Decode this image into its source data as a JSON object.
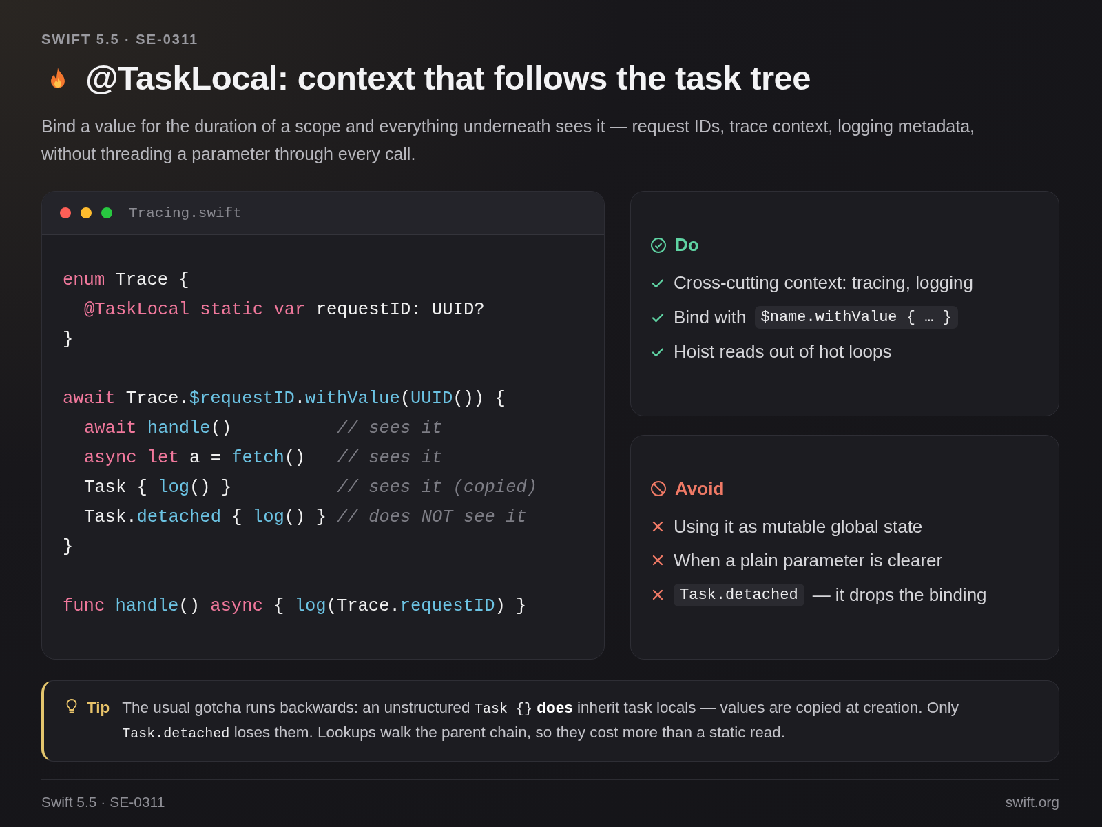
{
  "eyebrow": "SWIFT 5.5 · SE-0311",
  "title": "@TaskLocal: context that follows the task tree",
  "subtitle": "Bind a value for the duration of a scope and everything underneath sees it — request IDs, trace context, logging metadata, without threading a parameter through every call.",
  "code_window": {
    "filename": "Tracing.swift",
    "blocks": [
      [
        {
          "indent": false,
          "tokens": [
            {
              "kind": "kw",
              "t": "enum "
            },
            {
              "kind": "plain",
              "t": "Trace {"
            }
          ]
        },
        {
          "indent": true,
          "tokens": [
            {
              "kind": "kw",
              "t": "@TaskLocal static var "
            },
            {
              "kind": "plain",
              "t": "requestID: UUID?"
            }
          ]
        },
        {
          "indent": false,
          "tokens": [
            {
              "kind": "plain",
              "t": "}"
            }
          ]
        }
      ],
      [
        {
          "indent": false,
          "tokens": [
            {
              "kind": "kw",
              "t": "await "
            },
            {
              "kind": "plain",
              "t": "Trace."
            },
            {
              "kind": "fn",
              "t": "$requestID"
            },
            {
              "kind": "plain",
              "t": "."
            },
            {
              "kind": "fn",
              "t": "withValue"
            },
            {
              "kind": "plain",
              "t": "("
            },
            {
              "kind": "fn",
              "t": "UUID"
            },
            {
              "kind": "plain",
              "t": "()) {"
            }
          ]
        },
        {
          "indent": true,
          "tokens": [
            {
              "kind": "kw",
              "t": "await "
            },
            {
              "kind": "fn",
              "t": "handle"
            },
            {
              "kind": "plain",
              "t": "()          "
            },
            {
              "kind": "comment",
              "t": "// sees it"
            }
          ]
        },
        {
          "indent": true,
          "tokens": [
            {
              "kind": "kw",
              "t": "async let "
            },
            {
              "kind": "plain",
              "t": "a = "
            },
            {
              "kind": "fn",
              "t": "fetch"
            },
            {
              "kind": "plain",
              "t": "()   "
            },
            {
              "kind": "comment",
              "t": "// sees it"
            }
          ]
        },
        {
          "indent": true,
          "tokens": [
            {
              "kind": "plain",
              "t": "Task { "
            },
            {
              "kind": "fn",
              "t": "log"
            },
            {
              "kind": "plain",
              "t": "() }          "
            },
            {
              "kind": "comment",
              "t": "// sees it (copied)"
            }
          ]
        },
        {
          "indent": true,
          "tokens": [
            {
              "kind": "plain",
              "t": "Task."
            },
            {
              "kind": "fn",
              "t": "detached"
            },
            {
              "kind": "plain",
              "t": " { "
            },
            {
              "kind": "fn",
              "t": "log"
            },
            {
              "kind": "plain",
              "t": "() } "
            },
            {
              "kind": "comment",
              "t": "// does NOT see it"
            }
          ]
        },
        {
          "indent": false,
          "tokens": [
            {
              "kind": "plain",
              "t": "}"
            }
          ]
        }
      ],
      [
        {
          "indent": false,
          "tokens": [
            {
              "kind": "kw",
              "t": "func "
            },
            {
              "kind": "fn",
              "t": "handle"
            },
            {
              "kind": "plain",
              "t": "() "
            },
            {
              "kind": "kw",
              "t": "async "
            },
            {
              "kind": "plain",
              "t": "{ "
            },
            {
              "kind": "fn",
              "t": "log"
            },
            {
              "kind": "plain",
              "t": "(Trace."
            },
            {
              "kind": "fn",
              "t": "requestID"
            },
            {
              "kind": "plain",
              "t": ") }"
            }
          ]
        }
      ]
    ]
  },
  "panels": [
    {
      "kind": "do",
      "heading": "Do",
      "items": [
        [
          {
            "kind": "text",
            "text": "Cross-cutting context: tracing, logging"
          }
        ],
        [
          {
            "kind": "text",
            "text": "Bind with"
          },
          {
            "kind": "code",
            "text": "$name.withValue { … }"
          }
        ],
        [
          {
            "kind": "text",
            "text": "Hoist reads out of hot loops"
          }
        ]
      ]
    },
    {
      "kind": "avoid",
      "heading": "Avoid",
      "items": [
        [
          {
            "kind": "text",
            "text": "Using it as mutable global state"
          }
        ],
        [
          {
            "kind": "text",
            "text": "When a plain parameter is clearer"
          }
        ],
        [
          {
            "kind": "code",
            "text": "Task.detached"
          },
          {
            "kind": "text",
            "text": "— it drops the binding"
          }
        ]
      ]
    }
  ],
  "tip": {
    "label": "Tip",
    "segments": [
      {
        "kind": "text",
        "text": "The usual gotcha runs backwards: an unstructured "
      },
      {
        "kind": "code",
        "text": "Task {}"
      },
      {
        "kind": "text",
        "text": " **does** inherit task locals — values are copied at creation. Only "
      },
      {
        "kind": "code",
        "text": "Task.detached"
      },
      {
        "kind": "text",
        "text": " loses them. Lookups walk the parent chain, so they cost more than a static read."
      }
    ]
  },
  "footer": {
    "left": "Swift 5.5 · SE-0311",
    "right": "swift.org"
  }
}
